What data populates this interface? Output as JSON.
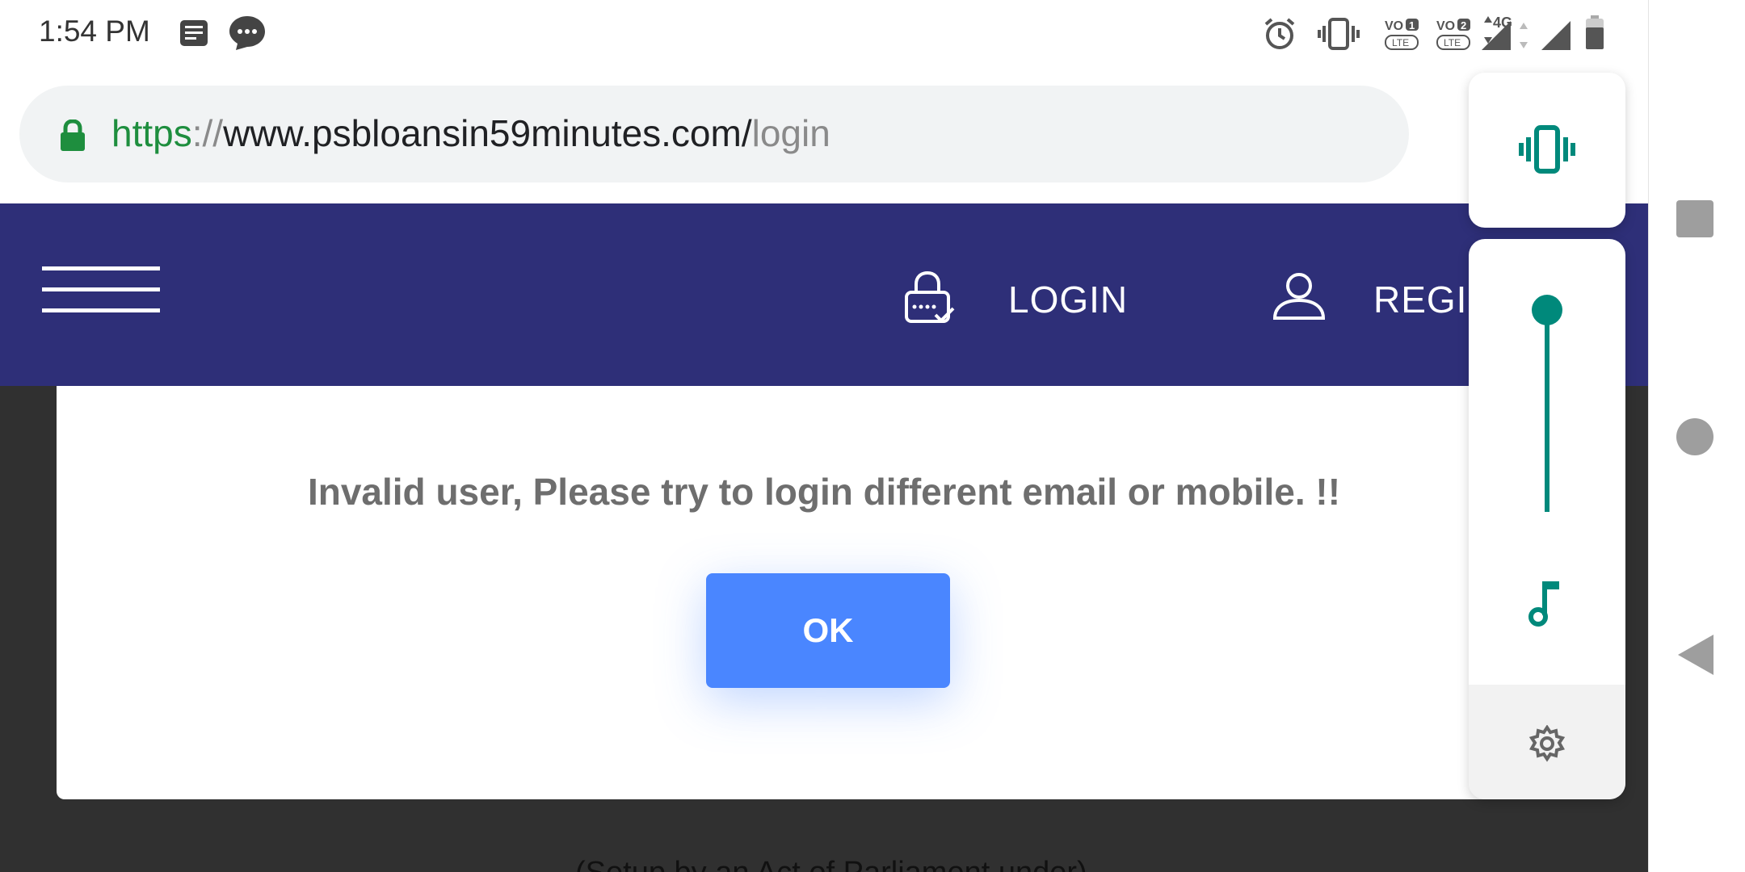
{
  "status_bar": {
    "time": "1:54 PM",
    "left_icons": [
      "notes-icon",
      "message-icon"
    ],
    "right_icons": [
      "alarm-icon",
      "vibrate-icon",
      "volte-sim1-icon",
      "volte-sim2-icon",
      "network-4g-icon",
      "signal-icon",
      "signal-icon",
      "battery-icon"
    ],
    "network_label": "4G",
    "volte_label": "VO",
    "lte_label": "LTE",
    "sim1": "1",
    "sim2": "2"
  },
  "browser": {
    "url_scheme": "https",
    "url_separator": "://",
    "url_host": "www.psbloansin59minutes.com/",
    "url_path": "login",
    "scheme_color": "#1e8e3e"
  },
  "site_header": {
    "background": "#2e2f78",
    "login_label": "LOGIN",
    "register_label": "REGISTER"
  },
  "dialog": {
    "message": "Invalid user, Please try to login different email or mobile. !!",
    "ok_label": "OK",
    "button_color": "#4a86ff"
  },
  "page": {
    "footer_text": "(Setup by an Act of Parliament under)"
  },
  "volume_panel": {
    "ringer_mode": "vibrate",
    "media_volume_fraction": 1.0,
    "accent_color": "#00897b",
    "stream_icon": "music-note-icon",
    "settings_icon": "gear-icon"
  },
  "nav_bar": {
    "buttons": [
      "recents-button",
      "home-button",
      "back-button"
    ]
  }
}
